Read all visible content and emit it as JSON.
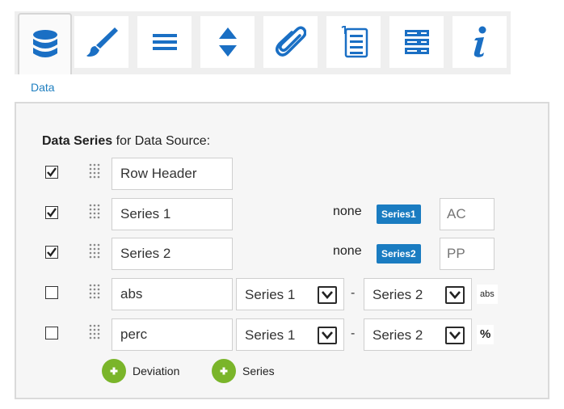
{
  "tabs": [
    {
      "name": "data",
      "icon": "database-icon",
      "active": true
    },
    {
      "name": "style",
      "icon": "brush-icon",
      "active": false
    },
    {
      "name": "lines",
      "icon": "menu-lines-icon",
      "active": false
    },
    {
      "name": "sort",
      "icon": "sort-arrows-icon",
      "active": false
    },
    {
      "name": "attachment",
      "icon": "paperclip-icon",
      "active": false
    },
    {
      "name": "list",
      "icon": "numbered-list-icon",
      "active": false
    },
    {
      "name": "server",
      "icon": "server-icon",
      "active": false
    },
    {
      "name": "info",
      "icon": "info-icon",
      "active": false
    }
  ],
  "active_tab_label": "Data",
  "panel": {
    "heading_bold": "Data Series",
    "heading_rest": " for Data Source:",
    "rows": [
      {
        "checked": true,
        "name": "Row Header"
      },
      {
        "checked": true,
        "name": "Series 1",
        "none_label": "none",
        "badge": "Series1",
        "code": "AC"
      },
      {
        "checked": true,
        "name": "Series 2",
        "none_label": "none",
        "badge": "Series2",
        "code": "PP"
      },
      {
        "checked": false,
        "name": "abs",
        "select_a": "Series 1",
        "dash": "-",
        "select_b": "Series 2",
        "unit": "abs"
      },
      {
        "checked": false,
        "name": "perc",
        "select_a": "Series 1",
        "dash": "-",
        "select_b": "Series 2",
        "unit": "%"
      }
    ],
    "add_deviation_label": "Deviation",
    "add_series_label": "Series"
  },
  "colors": {
    "accent": "#1f7fc0",
    "badge": "#1a7cc1",
    "add_button": "#7ab52a",
    "icon": "#1a6fc4"
  }
}
